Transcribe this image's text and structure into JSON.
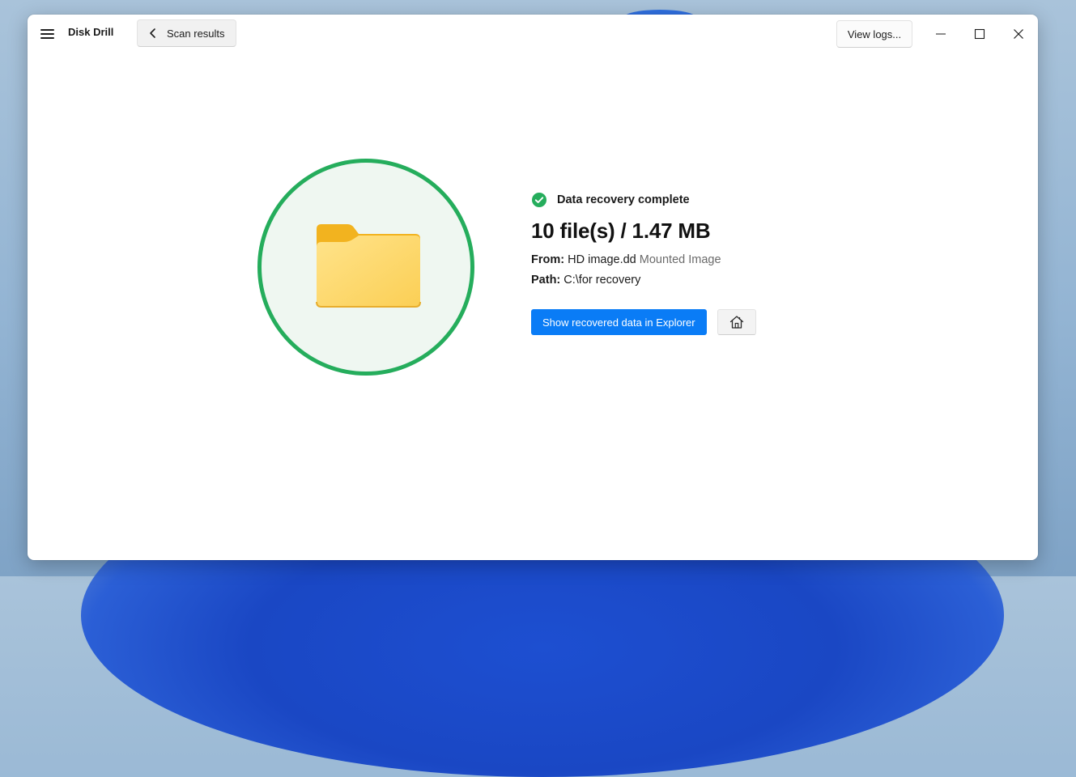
{
  "window": {
    "app_title": "Disk Drill",
    "back_label": "Scan results",
    "view_logs_label": "View logs..."
  },
  "window_controls": {
    "minimize": "minimize-icon",
    "maximize": "maximize-icon",
    "close": "close-icon"
  },
  "recovery": {
    "status": "Data recovery complete",
    "summary": "10 file(s) / 1.47 MB",
    "from_label": "From:",
    "from_value": "HD image.dd",
    "from_type": "Mounted Image",
    "path_label": "Path:",
    "path_value": "C:\\for recovery",
    "show_button_label": "Show recovered data in Explorer",
    "home_icon": "home-icon"
  },
  "colors": {
    "accent_blue": "#0a7cf6",
    "success_green": "#25ad5c",
    "folder_yellow": "#fbd35c"
  }
}
